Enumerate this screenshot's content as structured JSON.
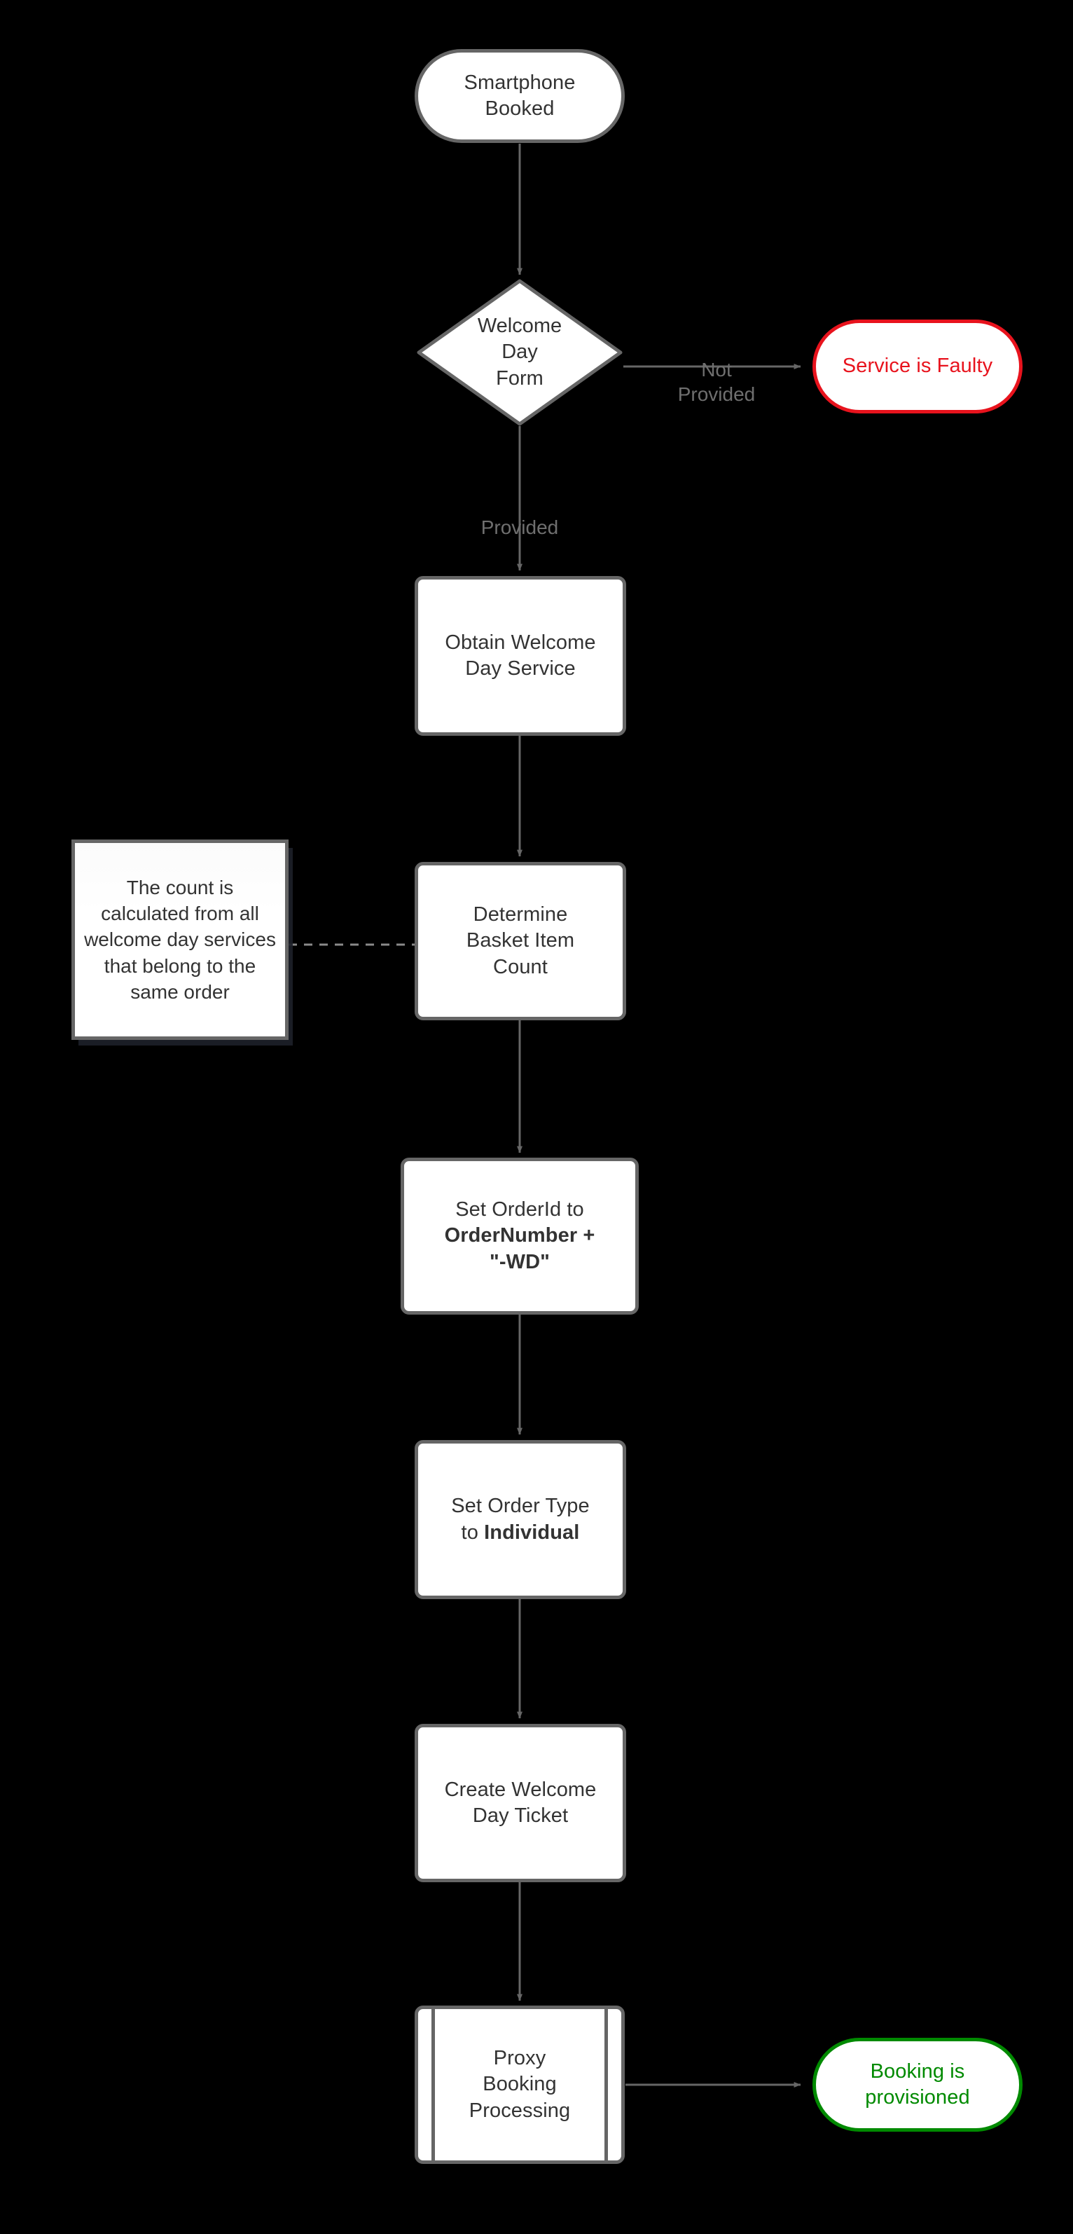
{
  "diagram": {
    "title": "Welcome Day Booking Provisioning Flow",
    "background": "#000000",
    "colors": {
      "node_stroke": "#666666",
      "node_fill": "#ffffff",
      "text": "#333333",
      "edge": "#666666",
      "edge_label": "#6f6f6f",
      "error": "#e8131d",
      "success": "#008a00"
    }
  },
  "nodes": {
    "start": {
      "label": "Smartphone\nBooked",
      "shape": "terminator"
    },
    "decision": {
      "label": "Welcome\nDay\nForm",
      "shape": "diamond"
    },
    "faulty": {
      "label": "Service is Faulty",
      "shape": "terminator",
      "color": "#e8131d"
    },
    "obtain": {
      "label": "Obtain Welcome\nDay Service",
      "shape": "process"
    },
    "determine": {
      "label": "Determine\nBasket Item\nCount",
      "shape": "process"
    },
    "set_orderid": {
      "shape": "process",
      "line1": "Set OrderId to",
      "line2": "OrderNumber +",
      "line3": "\"-WD\"",
      "bold_from_line": 2
    },
    "set_ordertype": {
      "shape": "process",
      "line1": "Set Order Type",
      "line2_prefix": "to ",
      "line2_bold": "Individual"
    },
    "create_ticket": {
      "label": "Create Welcome\nDay Ticket",
      "shape": "process"
    },
    "proxy": {
      "label": "Proxy\nBooking\nProcessing",
      "shape": "subprocess"
    },
    "provisioned": {
      "label": "Booking is\nprovisioned",
      "shape": "terminator",
      "color": "#008a00"
    }
  },
  "note": {
    "text": "The count is calculated from all welcome day services that belong to the same order"
  },
  "edges": [
    {
      "from": "start",
      "to": "decision",
      "label": ""
    },
    {
      "from": "decision",
      "to": "faulty",
      "label": "Not\nProvided"
    },
    {
      "from": "decision",
      "to": "obtain",
      "label": "Provided"
    },
    {
      "from": "obtain",
      "to": "determine",
      "label": ""
    },
    {
      "from": "determine",
      "to": "set_orderid",
      "label": ""
    },
    {
      "from": "set_orderid",
      "to": "set_ordertype",
      "label": ""
    },
    {
      "from": "set_ordertype",
      "to": "create_ticket",
      "label": ""
    },
    {
      "from": "create_ticket",
      "to": "proxy",
      "label": ""
    },
    {
      "from": "proxy",
      "to": "provisioned",
      "label": ""
    },
    {
      "from": "note",
      "to": "determine",
      "label": "",
      "style": "dashed"
    }
  ]
}
